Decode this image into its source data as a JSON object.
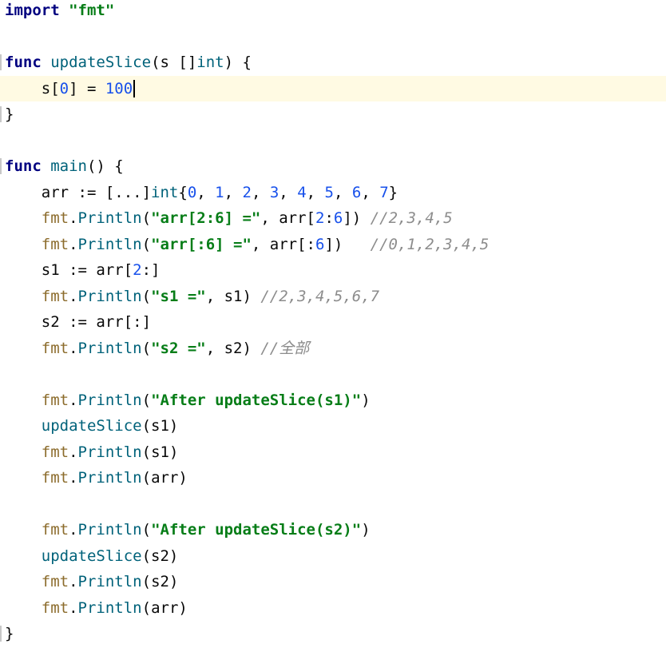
{
  "lines": [
    {
      "tokens": [
        {
          "t": "kw",
          "v": "import"
        },
        {
          "t": "plain",
          "v": " "
        },
        {
          "t": "str",
          "v": "\"fmt\""
        }
      ]
    },
    {
      "tokens": []
    },
    {
      "tokens": [
        {
          "t": "kw",
          "v": "func"
        },
        {
          "t": "plain",
          "v": " "
        },
        {
          "t": "fn",
          "v": "updateSlice"
        },
        {
          "t": "plain",
          "v": "(s []"
        },
        {
          "t": "fn",
          "v": "int"
        },
        {
          "t": "plain",
          "v": ") {"
        }
      ]
    },
    {
      "current": true,
      "tokens": [
        {
          "t": "plain",
          "v": "    s["
        },
        {
          "t": "num",
          "v": "0"
        },
        {
          "t": "plain",
          "v": "] = "
        },
        {
          "t": "num",
          "v": "100"
        },
        {
          "t": "caret",
          "v": ""
        }
      ]
    },
    {
      "tokens": [
        {
          "t": "plain",
          "v": "}"
        }
      ]
    },
    {
      "tokens": []
    },
    {
      "tokens": [
        {
          "t": "kw",
          "v": "func"
        },
        {
          "t": "plain",
          "v": " "
        },
        {
          "t": "fn",
          "v": "main"
        },
        {
          "t": "plain",
          "v": "() {"
        }
      ]
    },
    {
      "tokens": [
        {
          "t": "plain",
          "v": "    arr := [...]"
        },
        {
          "t": "fn",
          "v": "int"
        },
        {
          "t": "plain",
          "v": "{"
        },
        {
          "t": "num",
          "v": "0"
        },
        {
          "t": "plain",
          "v": ", "
        },
        {
          "t": "num",
          "v": "1"
        },
        {
          "t": "plain",
          "v": ", "
        },
        {
          "t": "num",
          "v": "2"
        },
        {
          "t": "plain",
          "v": ", "
        },
        {
          "t": "num",
          "v": "3"
        },
        {
          "t": "plain",
          "v": ", "
        },
        {
          "t": "num",
          "v": "4"
        },
        {
          "t": "plain",
          "v": ", "
        },
        {
          "t": "num",
          "v": "5"
        },
        {
          "t": "plain",
          "v": ", "
        },
        {
          "t": "num",
          "v": "6"
        },
        {
          "t": "plain",
          "v": ", "
        },
        {
          "t": "num",
          "v": "7"
        },
        {
          "t": "plain",
          "v": "}"
        }
      ]
    },
    {
      "tokens": [
        {
          "t": "plain",
          "v": "    "
        },
        {
          "t": "pkg",
          "v": "fmt"
        },
        {
          "t": "plain",
          "v": "."
        },
        {
          "t": "call",
          "v": "Println"
        },
        {
          "t": "plain",
          "v": "("
        },
        {
          "t": "str",
          "v": "\"arr[2:6] =\""
        },
        {
          "t": "plain",
          "v": ", arr["
        },
        {
          "t": "num",
          "v": "2"
        },
        {
          "t": "plain",
          "v": ":"
        },
        {
          "t": "num",
          "v": "6"
        },
        {
          "t": "plain",
          "v": "]) "
        },
        {
          "t": "cmt",
          "v": "//2,3,4,5"
        }
      ]
    },
    {
      "tokens": [
        {
          "t": "plain",
          "v": "    "
        },
        {
          "t": "pkg",
          "v": "fmt"
        },
        {
          "t": "plain",
          "v": "."
        },
        {
          "t": "call",
          "v": "Println"
        },
        {
          "t": "plain",
          "v": "("
        },
        {
          "t": "str",
          "v": "\"arr[:6] =\""
        },
        {
          "t": "plain",
          "v": ", arr[:"
        },
        {
          "t": "num",
          "v": "6"
        },
        {
          "t": "plain",
          "v": "])   "
        },
        {
          "t": "cmt",
          "v": "//0,1,2,3,4,5"
        }
      ]
    },
    {
      "tokens": [
        {
          "t": "plain",
          "v": "    s1 := arr["
        },
        {
          "t": "num",
          "v": "2"
        },
        {
          "t": "plain",
          "v": ":]"
        }
      ]
    },
    {
      "tokens": [
        {
          "t": "plain",
          "v": "    "
        },
        {
          "t": "pkg",
          "v": "fmt"
        },
        {
          "t": "plain",
          "v": "."
        },
        {
          "t": "call",
          "v": "Println"
        },
        {
          "t": "plain",
          "v": "("
        },
        {
          "t": "str",
          "v": "\"s1 =\""
        },
        {
          "t": "plain",
          "v": ", s1) "
        },
        {
          "t": "cmt",
          "v": "//2,3,4,5,6,7"
        }
      ]
    },
    {
      "tokens": [
        {
          "t": "plain",
          "v": "    s2 := arr[:]"
        }
      ]
    },
    {
      "tokens": [
        {
          "t": "plain",
          "v": "    "
        },
        {
          "t": "pkg",
          "v": "fmt"
        },
        {
          "t": "plain",
          "v": "."
        },
        {
          "t": "call",
          "v": "Println"
        },
        {
          "t": "plain",
          "v": "("
        },
        {
          "t": "str",
          "v": "\"s2 =\""
        },
        {
          "t": "plain",
          "v": ", s2) "
        },
        {
          "t": "cmt",
          "v": "//全部"
        }
      ]
    },
    {
      "tokens": []
    },
    {
      "tokens": [
        {
          "t": "plain",
          "v": "    "
        },
        {
          "t": "pkg",
          "v": "fmt"
        },
        {
          "t": "plain",
          "v": "."
        },
        {
          "t": "call",
          "v": "Println"
        },
        {
          "t": "plain",
          "v": "("
        },
        {
          "t": "str",
          "v": "\"After updateSlice(s1)\""
        },
        {
          "t": "plain",
          "v": ")"
        }
      ]
    },
    {
      "tokens": [
        {
          "t": "plain",
          "v": "    "
        },
        {
          "t": "call",
          "v": "updateSlice"
        },
        {
          "t": "plain",
          "v": "(s1)"
        }
      ]
    },
    {
      "tokens": [
        {
          "t": "plain",
          "v": "    "
        },
        {
          "t": "pkg",
          "v": "fmt"
        },
        {
          "t": "plain",
          "v": "."
        },
        {
          "t": "call",
          "v": "Println"
        },
        {
          "t": "plain",
          "v": "(s1)"
        }
      ]
    },
    {
      "tokens": [
        {
          "t": "plain",
          "v": "    "
        },
        {
          "t": "pkg",
          "v": "fmt"
        },
        {
          "t": "plain",
          "v": "."
        },
        {
          "t": "call",
          "v": "Println"
        },
        {
          "t": "plain",
          "v": "(arr)"
        }
      ]
    },
    {
      "tokens": []
    },
    {
      "tokens": [
        {
          "t": "plain",
          "v": "    "
        },
        {
          "t": "pkg",
          "v": "fmt"
        },
        {
          "t": "plain",
          "v": "."
        },
        {
          "t": "call",
          "v": "Println"
        },
        {
          "t": "plain",
          "v": "("
        },
        {
          "t": "str",
          "v": "\"After updateSlice(s2)\""
        },
        {
          "t": "plain",
          "v": ")"
        }
      ]
    },
    {
      "tokens": [
        {
          "t": "plain",
          "v": "    "
        },
        {
          "t": "call",
          "v": "updateSlice"
        },
        {
          "t": "plain",
          "v": "(s2)"
        }
      ]
    },
    {
      "tokens": [
        {
          "t": "plain",
          "v": "    "
        },
        {
          "t": "pkg",
          "v": "fmt"
        },
        {
          "t": "plain",
          "v": "."
        },
        {
          "t": "call",
          "v": "Println"
        },
        {
          "t": "plain",
          "v": "(s2)"
        }
      ]
    },
    {
      "tokens": [
        {
          "t": "plain",
          "v": "    "
        },
        {
          "t": "pkg",
          "v": "fmt"
        },
        {
          "t": "plain",
          "v": "."
        },
        {
          "t": "call",
          "v": "Println"
        },
        {
          "t": "plain",
          "v": "(arr)"
        }
      ]
    },
    {
      "tokens": [
        {
          "t": "plain",
          "v": "}"
        }
      ]
    }
  ]
}
